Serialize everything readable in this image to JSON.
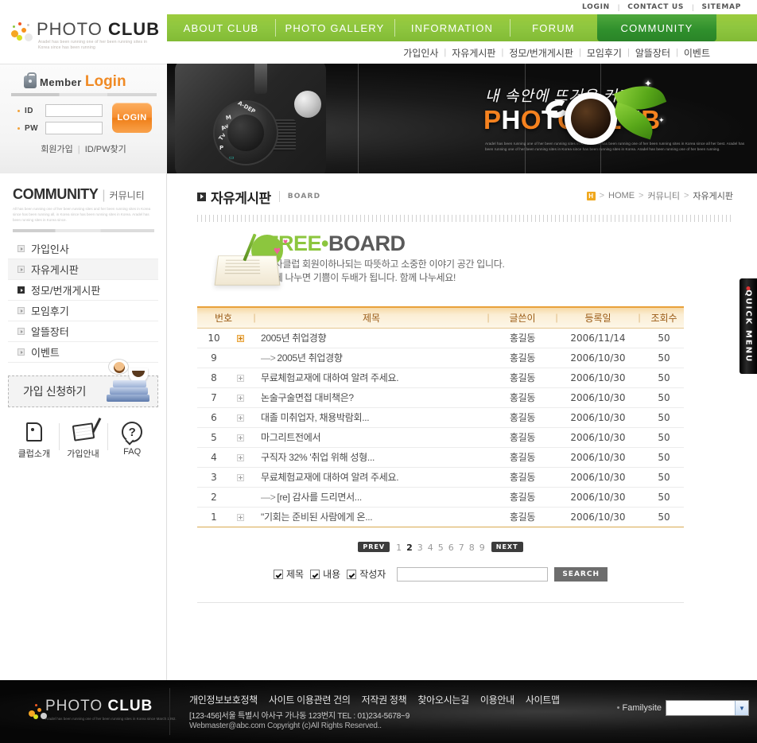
{
  "site": {
    "logo_main": "PHOTO ",
    "logo_bold": "CLUB",
    "logo_tagline": "Aradel has been running one of her been running sites in Korea since has been running"
  },
  "utility": {
    "links": [
      "LOGIN",
      "CONTACT US",
      "SITEMAP"
    ],
    "sep": "|"
  },
  "gnb": {
    "items": [
      {
        "label": "ABOUT CLUB",
        "active": false
      },
      {
        "label": "PHOTO GALLERY",
        "active": false
      },
      {
        "label": "INFORMATION",
        "active": false
      },
      {
        "label": "FORUM",
        "active": false
      },
      {
        "label": "COMMUNITY",
        "active": true
      }
    ]
  },
  "snb": {
    "items": [
      "가입인사",
      "자유게시판",
      "정모/번개게시판",
      "모임후기",
      "알뜰장터",
      "이벤트"
    ],
    "sep": "|"
  },
  "login": {
    "title_member": "Member",
    "title_login": "Login",
    "id_label": "ID",
    "pw_label": "PW",
    "id_value": "",
    "pw_value": "",
    "button": "LOGIN",
    "join_link": "회원가입",
    "find_link": "ID/PW찾기",
    "sep": "|"
  },
  "visual": {
    "headline": "내 속안에 뜨거운 커피!!",
    "title_p": "P",
    "title_rest_1": "H",
    "title_o": "O",
    "title_to": "TO",
    "title_club": "CLUB",
    "title_full": "PHOTO CLUB",
    "small_text": "Aradel has been running one of her been running sites in Korea since has been running one of her been running sites in Korea since all her best. Aradel has been running one of her been running sites in Korea since has been running sites in Korea. Aradel has been running one of her been running."
  },
  "lnb": {
    "head_en": "COMMUNITY",
    "head_bar": "|",
    "head_ko": "커뮤니티",
    "head_desc": "All has been running one of her been running sites and her been running sites in Korea since has been running all, in Korea since has been running sites in Korea. Aradel has been running sites in Korea since.",
    "items": [
      {
        "label": "가입인사",
        "state": "normal"
      },
      {
        "label": "자유게시판",
        "state": "on"
      },
      {
        "label": "정모/번개게시판",
        "state": "dark"
      },
      {
        "label": "모임후기",
        "state": "normal"
      },
      {
        "label": "알뜰장터",
        "state": "normal"
      },
      {
        "label": "이벤트",
        "state": "normal"
      }
    ],
    "join_banner": "가입 신청하기",
    "quick_icons": [
      {
        "label": "클럽소개",
        "icon": "speech-bubble-icon"
      },
      {
        "label": "가입안내",
        "icon": "book-pen-icon"
      },
      {
        "label": "FAQ",
        "icon": "question-mark-icon"
      }
    ]
  },
  "page": {
    "title_ko": "자유게시판",
    "title_en": "BOARD",
    "breadcrumb": {
      "home_icon": "H",
      "items": [
        "HOME",
        "커뮤니티",
        "자유게시판"
      ],
      "sep": ">"
    }
  },
  "board_banner": {
    "title_free": "FREE",
    "title_dot": "•",
    "title_board": "BOARD",
    "desc_line1": "야사클럽 회원이하나되는 따뜻하고 소중한 이야기 공간 입니다.",
    "desc_line2": "함께 나누면 기쁨이 두배가 됩니다. 함께 나누세요!"
  },
  "table": {
    "headers": [
      "번호",
      "제목",
      "글쓴이",
      "등록일",
      "조회수"
    ],
    "col_sep": "|",
    "rows": [
      {
        "no": "10",
        "icon": "hot",
        "reply": false,
        "title": "2005년 취업경향",
        "writer": "홍길동",
        "date": "2006/11/14",
        "hits": "50"
      },
      {
        "no": "9",
        "icon": "none",
        "reply": true,
        "title": "2005년 취업경향",
        "writer": "홍길동",
        "date": "2006/10/30",
        "hits": "50"
      },
      {
        "no": "8",
        "icon": "plus",
        "reply": false,
        "title": "무료체험교재에 대하여 알려 주세요.",
        "writer": "홍길동",
        "date": "2006/10/30",
        "hits": "50"
      },
      {
        "no": "7",
        "icon": "plus",
        "reply": false,
        "title": "논술구술면접 대비책은?",
        "writer": "홍길동",
        "date": "2006/10/30",
        "hits": "50"
      },
      {
        "no": "6",
        "icon": "plus",
        "reply": false,
        "title": "대졸 미취업자, 채용박람회...",
        "writer": "홍길동",
        "date": "2006/10/30",
        "hits": "50"
      },
      {
        "no": "5",
        "icon": "plus",
        "reply": false,
        "title": "마그리트전에서",
        "writer": "홍길동",
        "date": "2006/10/30",
        "hits": "50"
      },
      {
        "no": "4",
        "icon": "plus",
        "reply": false,
        "title": "구직자 32% '취업 위해 성형...",
        "writer": "홍길동",
        "date": "2006/10/30",
        "hits": "50"
      },
      {
        "no": "3",
        "icon": "plus",
        "reply": false,
        "title": "무료체험교재에 대하여 알려 주세요.",
        "writer": "홍길동",
        "date": "2006/10/30",
        "hits": "50"
      },
      {
        "no": "2",
        "icon": "none",
        "reply": true,
        "title": "[re] 감사를 드리면서...",
        "writer": "홍길동",
        "date": "2006/10/30",
        "hits": "50"
      },
      {
        "no": "1",
        "icon": "plus",
        "reply": false,
        "title": "\"기회는 준비된 사람에게 온...",
        "writer": "홍길동",
        "date": "2006/10/30",
        "hits": "50"
      }
    ],
    "reply_arrow": "—>"
  },
  "pager": {
    "prev": "PREV",
    "next": "NEXT",
    "pages": [
      "1",
      "2",
      "3",
      "4",
      "5",
      "6",
      "7",
      "8",
      "9"
    ],
    "current": "2"
  },
  "search": {
    "checkboxes": [
      "제목",
      "내용",
      "작성자"
    ],
    "value": "",
    "placeholder": "",
    "button": "SEARCH"
  },
  "quick_menu": {
    "label": "QUICK MENU"
  },
  "footer": {
    "logo_main": "PHOTO ",
    "logo_bold": "CLUB",
    "logo_sub": "Aradel has been running one of her been running sites in Korea since March 1992.",
    "links": [
      "개인정보보호정책",
      "사이트 이용관련 건의",
      "저작권 정책",
      "찾아오시는길",
      "이용안내",
      "사이트맵"
    ],
    "address": "[123-456]서울 특별시 아사구 가나동 123번지 TEL : 01)234-5678~9",
    "copyright": "Webmaster@abc.com Copyright (c)All Rights Reserved..",
    "family_bullet": "•",
    "family_label": "Familysite",
    "family_selected": "",
    "family_arrow": "▼"
  },
  "colors": {
    "green": "#8ec63f",
    "green_dark": "#2f8f2c",
    "orange": "#f08a24",
    "header_orange": "#e9a13b",
    "text_dark": "#2f2f2f"
  }
}
